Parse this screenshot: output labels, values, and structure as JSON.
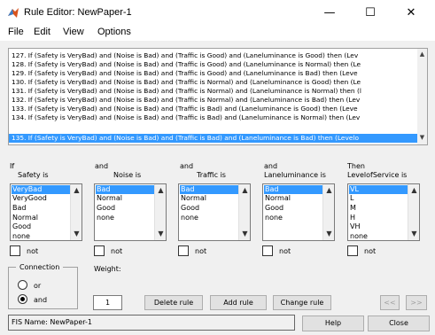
{
  "window": {
    "title": "Rule Editor: NewPaper-1",
    "minimize_glyph": "—",
    "maximize_glyph": "☐",
    "close_glyph": "✕"
  },
  "menu": [
    "File",
    "Edit",
    "View",
    "Options"
  ],
  "rules": [
    "127. If (Safety is VeryBad) and (Noise is Bad) and (Traffic is Good) and (Laneluminance is Good) then (Lev",
    "128. If (Safety is VeryBad) and (Noise is Bad) and (Traffic is Good) and (Laneluminance is Normal) then (Le",
    "129. If (Safety is VeryBad) and (Noise is Bad) and (Traffic is Good) and (Laneluminance is Bad) then (Leve",
    "130. If (Safety is VeryBad) and (Noise is Bad) and (Traffic is Normal) and (Laneluminance is Good) then (Le",
    "131. If (Safety is VeryBad) and (Noise is Bad) and (Traffic is Normal) and (Laneluminance is Normal) then (l",
    "132. If (Safety is VeryBad) and (Noise is Bad) and (Traffic is Normal) and (Laneluminance is Bad) then (Lev",
    "133. If (Safety is VeryBad) and (Noise is Bad) and (Traffic is Bad) and (Laneluminance is Good) then (Leve",
    "134. If (Safety is VeryBad) and (Noise is Bad) and (Traffic is Bad) and (Laneluminance is Normal) then (Lev",
    "135. If (Safety is VeryBad) and (Noise is Bad) and (Traffic is Bad) and (Laneluminance is Bad) then (Levelo"
  ],
  "selected_rule_index": 8,
  "columns": [
    {
      "connector": "If",
      "label": "Safety is",
      "items": [
        "VeryBad",
        "VeryGood",
        "Bad",
        "Normal",
        "Good",
        "none"
      ],
      "selected": 0,
      "not_label": "not"
    },
    {
      "connector": "and",
      "label": "Noise is",
      "items": [
        "Bad",
        "Normal",
        "Good",
        "none"
      ],
      "selected": 0,
      "not_label": "not"
    },
    {
      "connector": "and",
      "label": "Traffic is",
      "items": [
        "Bad",
        "Normal",
        "Good",
        "none"
      ],
      "selected": 0,
      "not_label": "not"
    },
    {
      "connector": "and",
      "label": "Laneluminance is",
      "items": [
        "Bad",
        "Normal",
        "Good",
        "none"
      ],
      "selected": 0,
      "not_label": "not"
    },
    {
      "connector": "Then",
      "label": "LevelofService is",
      "items": [
        "VL",
        "L",
        "M",
        "H",
        "VH",
        "none"
      ],
      "selected": 0,
      "not_label": "not"
    }
  ],
  "connection": {
    "title": "Connection",
    "options": [
      "or",
      "and"
    ],
    "selected": "and"
  },
  "weight": {
    "label": "Weight:",
    "value": "1"
  },
  "buttons": {
    "delete_rule": "Delete rule",
    "add_rule": "Add rule",
    "change_rule": "Change rule",
    "prev": "<<",
    "next": ">>",
    "help": "Help",
    "close": "Close"
  },
  "status": "FIS Name: NewPaper-1",
  "colors": {
    "selection": "#3399ff",
    "background": "#f0f0f0"
  }
}
